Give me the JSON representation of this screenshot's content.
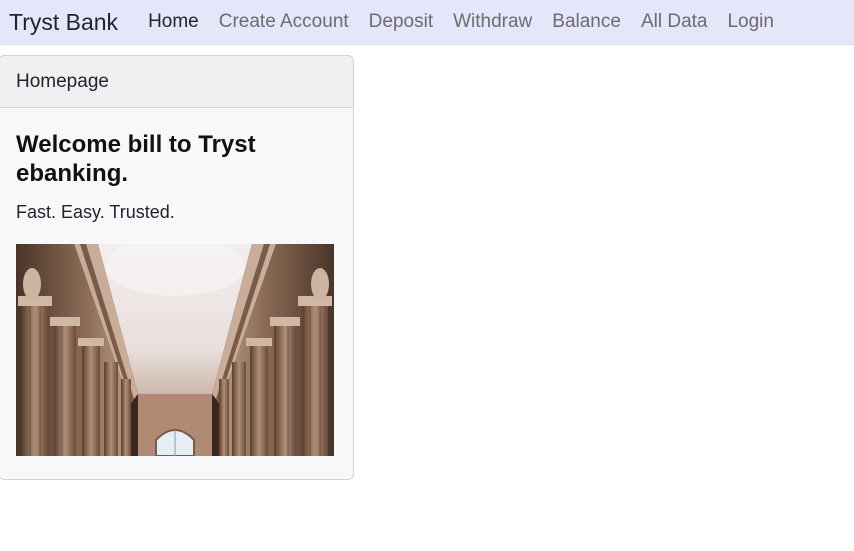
{
  "navbar": {
    "brand": "Tryst Bank",
    "links": [
      {
        "label": "Home"
      },
      {
        "label": "Create Account"
      },
      {
        "label": "Deposit"
      },
      {
        "label": "Withdraw"
      },
      {
        "label": "Balance"
      },
      {
        "label": "All Data"
      },
      {
        "label": "Login"
      }
    ],
    "background": "#e6e6fa"
  },
  "card": {
    "header": "Homepage",
    "title": "Welcome bill to Tryst ebanking.",
    "text": "Fast. Easy. Trusted.",
    "image_icon": "bank-hall-columns-image"
  }
}
